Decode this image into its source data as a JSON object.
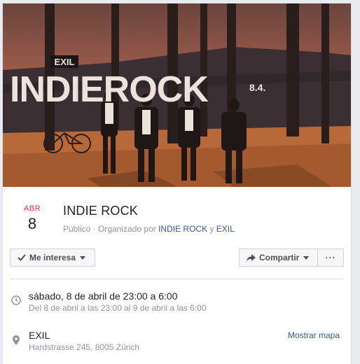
{
  "cover": {
    "sign_exil": "EXIL",
    "sign_indierock": "INDIEROCK",
    "sign_date": "8.4."
  },
  "event": {
    "month": "ABR",
    "day": "8",
    "title": "INDIE ROCK",
    "privacy": "Público",
    "organized_by": " · Organizado por ",
    "organizer_1": "INDIE ROCK",
    "and": " y ",
    "organizer_2": "EXIL"
  },
  "actions": {
    "interest_label": "Me interesa",
    "share_label": "Compartir",
    "more_label": "···"
  },
  "details": {
    "time_main": "sábado, 8 de abril de 23:00 a 6:00",
    "time_sub": "Del 8 de abril a las 23:00 al 9 de abril a las 6:00",
    "venue": "EXIL",
    "address": "Hardstrasse 245, 8005 Zürich",
    "map_link": "Mostrar mapa"
  },
  "colors": {
    "month_red": "#f02849",
    "link_blue": "#365899",
    "muted_gray": "#90949c"
  }
}
